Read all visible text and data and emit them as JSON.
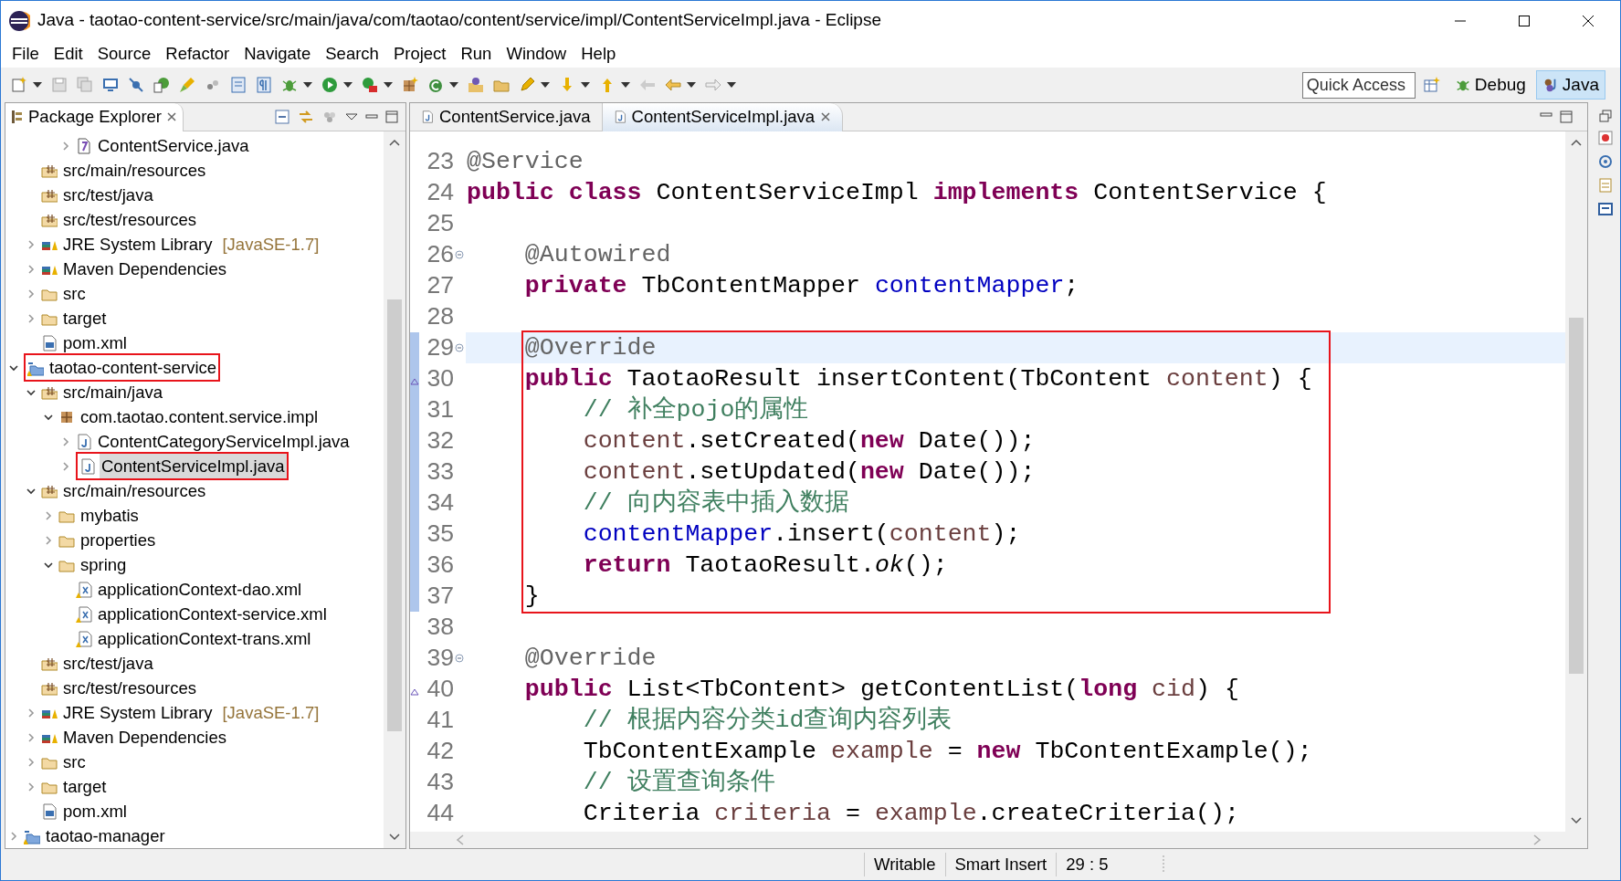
{
  "window": {
    "title": "Java - taotao-content-service/src/main/java/com/taotao/content/service/impl/ContentServiceImpl.java - Eclipse"
  },
  "menu": [
    "File",
    "Edit",
    "Source",
    "Refactor",
    "Navigate",
    "Search",
    "Project",
    "Run",
    "Window",
    "Help"
  ],
  "quick_access": {
    "placeholder": "Quick Access"
  },
  "perspectives": [
    {
      "label": "Debug",
      "kind": "debug",
      "selected": false
    },
    {
      "label": "Java",
      "kind": "java",
      "selected": true
    }
  ],
  "package_explorer": {
    "title": "Package Explorer",
    "items": [
      {
        "children": [
          {
            "children": [
              {
                "children": [
                  {
                    "label": "ContentService.java",
                    "kind": "interface",
                    "expanded": false,
                    "selected": false,
                    "boxed": false
                  }
                ]
              }
            ]
          },
          {
            "label": "src/main/resources",
            "kind": "source",
            "selected": false,
            "boxed": false
          },
          {
            "label": "src/test/java",
            "kind": "source",
            "selected": false,
            "boxed": false
          },
          {
            "label": "src/test/resources",
            "kind": "source",
            "selected": false,
            "boxed": false
          },
          {
            "label": "JRE System Library",
            "decoration": "[JavaSE-1.7]",
            "kind": "library",
            "expanded": false,
            "selected": false,
            "boxed": false
          },
          {
            "label": "Maven Dependencies",
            "kind": "library",
            "expanded": false,
            "selected": false,
            "boxed": false
          },
          {
            "label": "src",
            "kind": "folder",
            "expanded": false,
            "selected": false,
            "boxed": false
          },
          {
            "label": "target",
            "kind": "folder",
            "expanded": false,
            "selected": false,
            "boxed": false
          },
          {
            "label": "pom.xml",
            "kind": "maven",
            "selected": false,
            "boxed": false
          }
        ]
      },
      {
        "label": "taotao-content-service",
        "kind": "project",
        "expanded": true,
        "selected": false,
        "boxed": true,
        "children": [
          {
            "label": "src/main/java",
            "kind": "source",
            "expanded": true,
            "selected": false,
            "boxed": false,
            "children": [
              {
                "label": "com.taotao.content.service.impl",
                "kind": "package",
                "expanded": true,
                "selected": false,
                "boxed": false,
                "children": [
                  {
                    "label": "ContentCategoryServiceImpl.java",
                    "kind": "java",
                    "expanded": false,
                    "selected": false,
                    "boxed": false
                  },
                  {
                    "label": "ContentServiceImpl.java",
                    "kind": "java",
                    "expanded": false,
                    "selected": true,
                    "boxed": true
                  }
                ]
              }
            ]
          },
          {
            "label": "src/main/resources",
            "kind": "source",
            "expanded": true,
            "selected": false,
            "boxed": false,
            "children": [
              {
                "label": "mybatis",
                "kind": "folder",
                "expanded": false,
                "selected": false,
                "boxed": false
              },
              {
                "label": "properties",
                "kind": "folder",
                "expanded": false,
                "selected": false,
                "boxed": false
              },
              {
                "label": "spring",
                "kind": "folder",
                "expanded": true,
                "selected": false,
                "boxed": false,
                "children": [
                  {
                    "label": "applicationContext-dao.xml",
                    "kind": "xml",
                    "selected": false,
                    "boxed": false
                  },
                  {
                    "label": "applicationContext-service.xml",
                    "kind": "xml",
                    "selected": false,
                    "boxed": false
                  },
                  {
                    "label": "applicationContext-trans.xml",
                    "kind": "xml",
                    "selected": false,
                    "boxed": false
                  }
                ]
              }
            ]
          },
          {
            "label": "src/test/java",
            "kind": "source",
            "selected": false,
            "boxed": false
          },
          {
            "label": "src/test/resources",
            "kind": "source",
            "selected": false,
            "boxed": false
          },
          {
            "label": "JRE System Library",
            "decoration": "[JavaSE-1.7]",
            "kind": "library",
            "expanded": false,
            "selected": false,
            "boxed": false
          },
          {
            "label": "Maven Dependencies",
            "kind": "library",
            "expanded": false,
            "selected": false,
            "boxed": false
          },
          {
            "label": "src",
            "kind": "folder",
            "expanded": false,
            "selected": false,
            "boxed": false
          },
          {
            "label": "target",
            "kind": "folder",
            "expanded": false,
            "selected": false,
            "boxed": false
          },
          {
            "label": "pom.xml",
            "kind": "maven",
            "selected": false,
            "boxed": false
          }
        ]
      },
      {
        "label": "taotao-manager",
        "kind": "project",
        "expanded": false,
        "selected": false,
        "boxed": false
      }
    ]
  },
  "editor_tabs": [
    {
      "label": "ContentService.java",
      "selected": false
    },
    {
      "label": "ContentServiceImpl.java",
      "selected": true
    }
  ],
  "code_blocks": [
    {
      "boxed": false,
      "lines": [
        {
          "number": "23",
          "current": false,
          "fold": false,
          "override": false,
          "scope": false,
          "tokens": [
            {
              "kind": "annotation",
              "text": "@Service"
            }
          ]
        },
        {
          "number": "24",
          "current": false,
          "fold": false,
          "override": false,
          "scope": false,
          "tokens": [
            {
              "kind": "keyword",
              "text": "public "
            },
            {
              "kind": "keyword",
              "text": "class"
            },
            {
              "kind": "plain",
              "text": " ContentServiceImpl "
            },
            {
              "kind": "keyword",
              "text": "implements"
            },
            {
              "kind": "plain",
              "text": " ContentService {"
            }
          ]
        },
        {
          "number": "25",
          "current": false,
          "fold": false,
          "override": false,
          "scope": false
        },
        {
          "number": "26",
          "current": false,
          "fold": true,
          "override": false,
          "scope": false,
          "tokens": [
            {
              "kind": "annotation",
              "text": "    @Autowired"
            }
          ]
        },
        {
          "number": "27",
          "current": false,
          "fold": false,
          "override": false,
          "scope": false,
          "tokens": [
            {
              "kind": "keyword",
              "text": "    private"
            },
            {
              "kind": "plain",
              "text": " TbContentMapper "
            },
            {
              "kind": "field",
              "text": "contentMapper"
            },
            {
              "kind": "plain",
              "text": ";"
            }
          ]
        },
        {
          "number": "28",
          "current": false,
          "fold": false,
          "override": false,
          "scope": false
        }
      ]
    },
    {
      "boxed": true,
      "lines": [
        {
          "number": "29",
          "current": true,
          "fold": true,
          "override": false,
          "scope": true,
          "tokens": [
            {
              "kind": "annotation",
              "text": "    @Override"
            }
          ]
        },
        {
          "number": "30",
          "current": false,
          "fold": false,
          "override": true,
          "scope": true,
          "tokens": [
            {
              "kind": "keyword",
              "text": "    public"
            },
            {
              "kind": "plain",
              "text": " TaotaoResult insertContent(TbContent "
            },
            {
              "kind": "local",
              "text": "content"
            },
            {
              "kind": "plain",
              "text": ") {"
            }
          ]
        },
        {
          "number": "31",
          "current": false,
          "fold": false,
          "override": false,
          "scope": true,
          "tokens": [
            {
              "kind": "comment",
              "text": "        // 补全pojo的属性"
            }
          ]
        },
        {
          "number": "32",
          "current": false,
          "fold": false,
          "override": false,
          "scope": true,
          "tokens": [
            {
              "kind": "local",
              "text": "        content"
            },
            {
              "kind": "plain",
              "text": ".setCreated("
            },
            {
              "kind": "keyword",
              "text": "new"
            },
            {
              "kind": "plain",
              "text": " Date());"
            }
          ]
        },
        {
          "number": "33",
          "current": false,
          "fold": false,
          "override": false,
          "scope": true,
          "tokens": [
            {
              "kind": "local",
              "text": "        content"
            },
            {
              "kind": "plain",
              "text": ".setUpdated("
            },
            {
              "kind": "keyword",
              "text": "new"
            },
            {
              "kind": "plain",
              "text": " Date());"
            }
          ]
        },
        {
          "number": "34",
          "current": false,
          "fold": false,
          "override": false,
          "scope": true,
          "tokens": [
            {
              "kind": "comment",
              "text": "        // 向内容表中插入数据"
            }
          ]
        },
        {
          "number": "35",
          "current": false,
          "fold": false,
          "override": false,
          "scope": true,
          "tokens": [
            {
              "kind": "field",
              "text": "        contentMapper"
            },
            {
              "kind": "plain",
              "text": ".insert("
            },
            {
              "kind": "local",
              "text": "content"
            },
            {
              "kind": "plain",
              "text": ");"
            }
          ]
        },
        {
          "number": "36",
          "current": false,
          "fold": false,
          "override": false,
          "scope": true,
          "tokens": [
            {
              "kind": "keyword",
              "text": "        return"
            },
            {
              "kind": "plain",
              "text": " TaotaoResult."
            },
            {
              "kind": "static",
              "text": "ok"
            },
            {
              "kind": "plain",
              "text": "();"
            }
          ]
        },
        {
          "number": "37",
          "current": false,
          "fold": false,
          "override": false,
          "scope": true,
          "tokens": [
            {
              "kind": "plain",
              "text": "    }"
            }
          ]
        }
      ]
    },
    {
      "boxed": false,
      "lines": [
        {
          "number": "38",
          "current": false,
          "fold": false,
          "override": false,
          "scope": false
        },
        {
          "number": "39",
          "current": false,
          "fold": true,
          "override": false,
          "scope": false,
          "tokens": [
            {
              "kind": "annotation",
              "text": "    @Override"
            }
          ]
        },
        {
          "number": "40",
          "current": false,
          "fold": false,
          "override": true,
          "scope": false,
          "tokens": [
            {
              "kind": "keyword",
              "text": "    public"
            },
            {
              "kind": "plain",
              "text": " List<TbContent> getContentList("
            },
            {
              "kind": "keyword",
              "text": "long"
            },
            {
              "kind": "local",
              "text": " cid"
            },
            {
              "kind": "plain",
              "text": ") {"
            }
          ]
        },
        {
          "number": "41",
          "current": false,
          "fold": false,
          "override": false,
          "scope": false,
          "tokens": [
            {
              "kind": "comment",
              "text": "        // 根据内容分类id查询内容列表"
            }
          ]
        },
        {
          "number": "42",
          "current": false,
          "fold": false,
          "override": false,
          "scope": false,
          "tokens": [
            {
              "kind": "plain",
              "text": "        TbContentExample "
            },
            {
              "kind": "local",
              "text": "example"
            },
            {
              "kind": "plain",
              "text": " = "
            },
            {
              "kind": "keyword",
              "text": "new"
            },
            {
              "kind": "plain",
              "text": " TbContentExample();"
            }
          ]
        },
        {
          "number": "43",
          "current": false,
          "fold": false,
          "override": false,
          "scope": false,
          "tokens": [
            {
              "kind": "comment",
              "text": "        // 设置查询条件"
            }
          ]
        },
        {
          "number": "44",
          "current": false,
          "fold": false,
          "override": false,
          "scope": false,
          "tokens": [
            {
              "kind": "plain",
              "text": "        Criteria "
            },
            {
              "kind": "local",
              "text": "criteria"
            },
            {
              "kind": "plain",
              "text": " = "
            },
            {
              "kind": "local",
              "text": "example"
            },
            {
              "kind": "plain",
              "text": ".createCriteria();"
            }
          ]
        }
      ]
    }
  ],
  "status_bar": [
    "Writable",
    "Smart Insert",
    "29 : 5"
  ]
}
